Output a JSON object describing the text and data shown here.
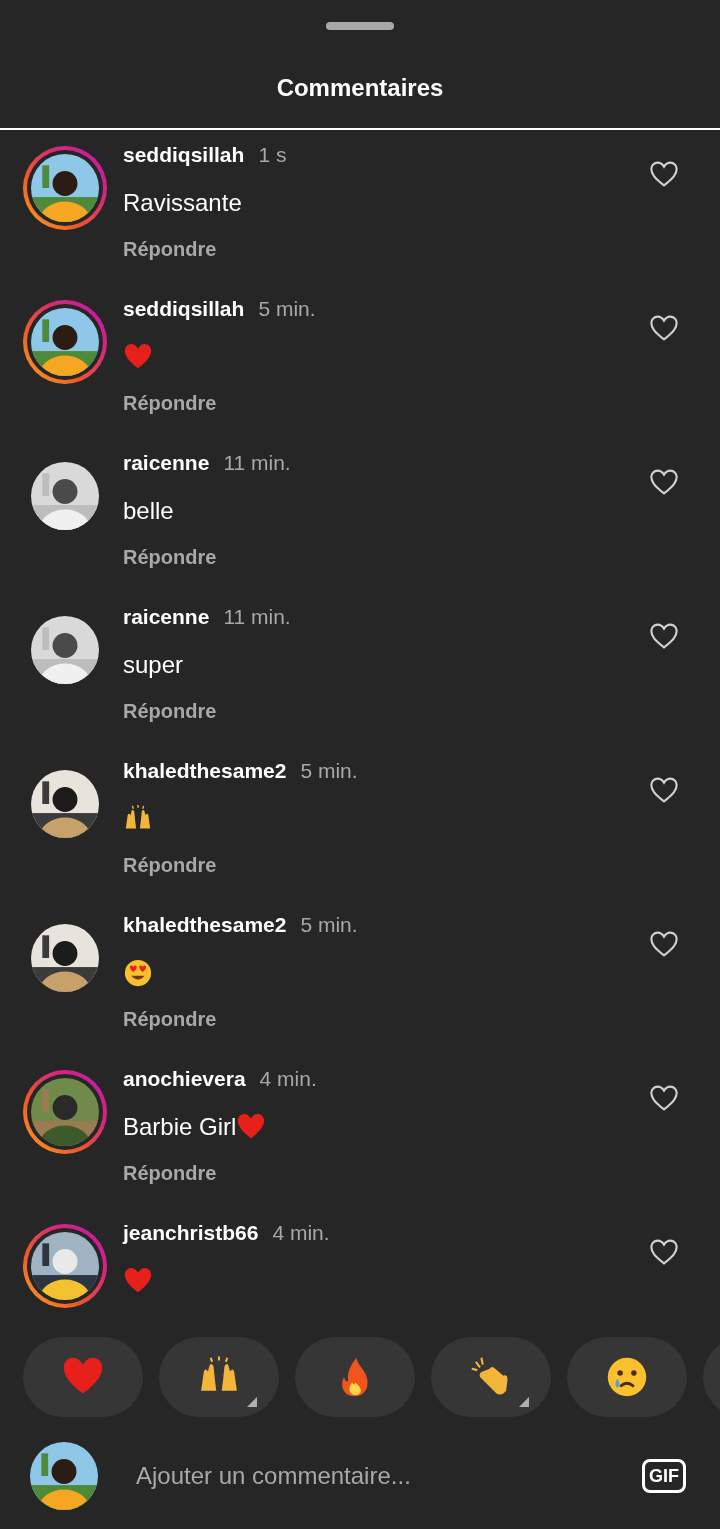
{
  "title": "Commentaires",
  "comments": [
    {
      "username": "seddiqsillah",
      "time": "1 s",
      "kind": "text",
      "text": "Ravissante",
      "story_ring": true,
      "reply": "Répondre"
    },
    {
      "username": "seddiqsillah",
      "time": "5 min.",
      "kind": "heart",
      "story_ring": true,
      "reply": "Répondre"
    },
    {
      "username": "raicenne",
      "time": "11 min.",
      "kind": "text",
      "text": "belle",
      "story_ring": false,
      "reply": "Répondre"
    },
    {
      "username": "raicenne",
      "time": "11 min.",
      "kind": "text",
      "text": "super",
      "story_ring": false,
      "reply": "Répondre"
    },
    {
      "username": "khaledthesame2",
      "time": "5 min.",
      "kind": "raised-hands",
      "story_ring": false,
      "reply": "Répondre"
    },
    {
      "username": "khaledthesame2",
      "time": "5 min.",
      "kind": "heart-eyes",
      "story_ring": false,
      "reply": "Répondre"
    },
    {
      "username": "anochievera",
      "time": "4 min.",
      "kind": "text-heart",
      "text": "Barbie Girl",
      "story_ring": true,
      "reply": "Répondre"
    },
    {
      "username": "jeanchristb66",
      "time": "4 min.",
      "kind": "heart",
      "story_ring": true
    }
  ],
  "quick_reactions": [
    {
      "kind": "heart",
      "variants": false
    },
    {
      "kind": "raised-hands",
      "variants": true
    },
    {
      "kind": "fire",
      "variants": false
    },
    {
      "kind": "clapping",
      "variants": true
    },
    {
      "kind": "crying",
      "variants": false
    }
  ],
  "composer": {
    "placeholder": "Ajouter un commentaire...",
    "gif_label": "GIF"
  }
}
